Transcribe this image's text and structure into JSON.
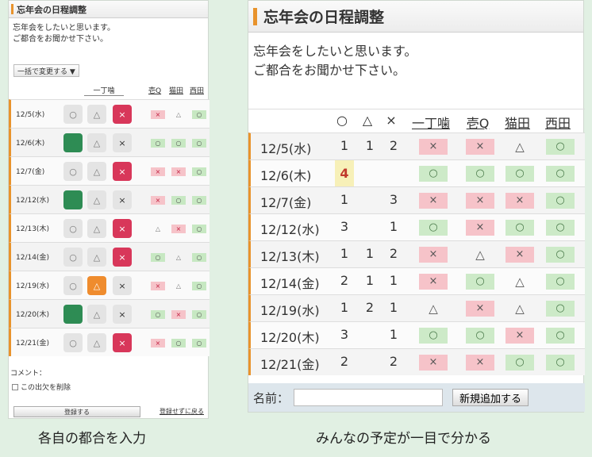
{
  "left": {
    "title": "忘年会の日程調整",
    "desc1": "忘年会をしたいと思います。",
    "desc2": "ご都合をお聞かせ下さい。",
    "bulk_label": "一括で変更する ▼",
    "head_self": "一丁噛",
    "members": [
      "壱Q",
      "猫田",
      "西田"
    ],
    "rows": [
      {
        "date": "12/5(水)",
        "sel": "x",
        "m": [
          "x",
          "t",
          "o"
        ]
      },
      {
        "date": "12/6(木)",
        "sel": "o",
        "m": [
          "o",
          "o",
          "o"
        ]
      },
      {
        "date": "12/7(金)",
        "sel": "x",
        "m": [
          "x",
          "x",
          "o"
        ]
      },
      {
        "date": "12/12(水)",
        "sel": "o",
        "m": [
          "x",
          "o",
          "o"
        ]
      },
      {
        "date": "12/13(木)",
        "sel": "x",
        "m": [
          "t",
          "x",
          "o"
        ]
      },
      {
        "date": "12/14(金)",
        "sel": "x",
        "m": [
          "o",
          "t",
          "o"
        ]
      },
      {
        "date": "12/19(水)",
        "sel": "t",
        "m": [
          "x",
          "t",
          "o"
        ]
      },
      {
        "date": "12/20(木)",
        "sel": "o",
        "m": [
          "o",
          "x",
          "o"
        ]
      },
      {
        "date": "12/21(金)",
        "sel": "x",
        "m": [
          "x",
          "o",
          "o"
        ]
      }
    ],
    "comment_label": "コメント：",
    "delete_label": "この出欠を削除",
    "submit_label": "登録する",
    "back_label": "登録せずに戻る"
  },
  "right": {
    "title": "忘年会の日程調整",
    "desc1": "忘年会をしたいと思います。",
    "desc2": "ご都合をお聞かせ下さい。",
    "head_counts": [
      "○",
      "△",
      "×"
    ],
    "members": [
      "一丁噛",
      "壱Q",
      "猫田",
      "西田"
    ],
    "rows": [
      {
        "date": "12/5(水)",
        "c": [
          "1",
          "1",
          "2"
        ],
        "m": [
          "x",
          "x",
          "t",
          "o"
        ]
      },
      {
        "date": "12/6(木)",
        "c": [
          "4",
          "",
          ""
        ],
        "m": [
          "o",
          "o",
          "o",
          "o"
        ],
        "hl": true
      },
      {
        "date": "12/7(金)",
        "c": [
          "1",
          "",
          "3"
        ],
        "m": [
          "x",
          "x",
          "x",
          "o"
        ]
      },
      {
        "date": "12/12(水)",
        "c": [
          "3",
          "",
          "1"
        ],
        "m": [
          "o",
          "x",
          "o",
          "o"
        ]
      },
      {
        "date": "12/13(木)",
        "c": [
          "1",
          "1",
          "2"
        ],
        "m": [
          "x",
          "t",
          "x",
          "o"
        ]
      },
      {
        "date": "12/14(金)",
        "c": [
          "2",
          "1",
          "1"
        ],
        "m": [
          "x",
          "o",
          "t",
          "o"
        ]
      },
      {
        "date": "12/19(水)",
        "c": [
          "1",
          "2",
          "1"
        ],
        "m": [
          "t",
          "x",
          "t",
          "o"
        ]
      },
      {
        "date": "12/20(木)",
        "c": [
          "3",
          "",
          "1"
        ],
        "m": [
          "o",
          "o",
          "x",
          "o"
        ]
      },
      {
        "date": "12/21(金)",
        "c": [
          "2",
          "",
          "2"
        ],
        "m": [
          "x",
          "x",
          "o",
          "o"
        ]
      }
    ],
    "name_label": "名前：",
    "add_label": "新規追加する"
  },
  "symbols": {
    "o": "○",
    "t": "△",
    "x": "×"
  },
  "captions": {
    "left": "各自の都合を入力",
    "right": "みんなの予定が一目で分かる"
  },
  "colors": {
    "accent": "#e8932c",
    "ok_bg": "#cdeac8",
    "ng_bg": "#f6c3c9",
    "maybe_sel": "#ef8c2e",
    "ok_sel": "#2e8c54",
    "ng_sel": "#d8375a",
    "highlight": "#f7f0b8"
  }
}
